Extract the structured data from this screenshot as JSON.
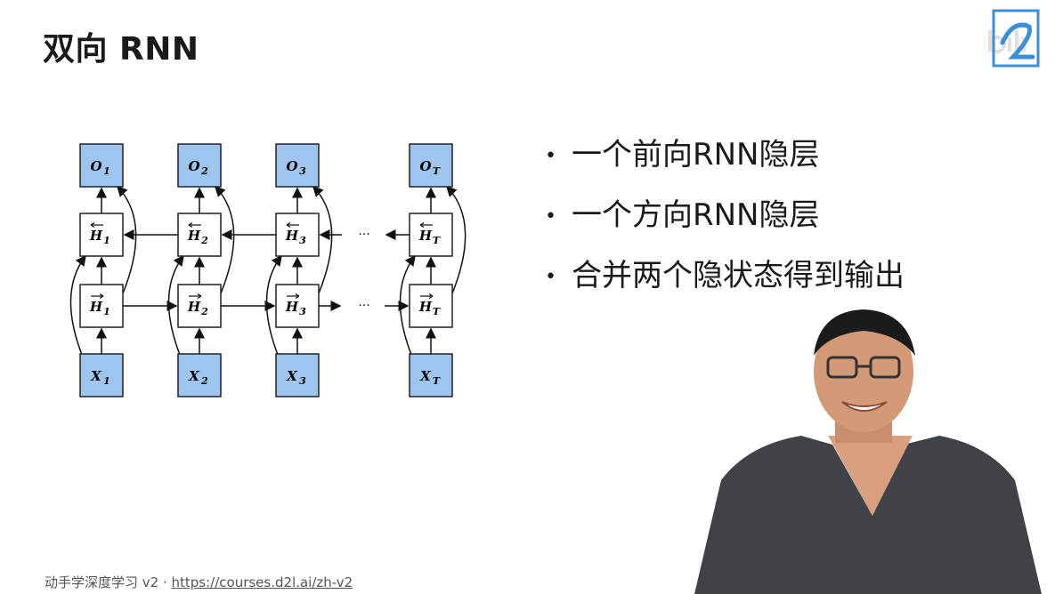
{
  "slide": {
    "title": "双向 RNN",
    "bullets": [
      "一个前向RNN隐层",
      "一个方向RNN隐层",
      "合并两个隐状态得到输出"
    ]
  },
  "diagram": {
    "outputs": [
      "O",
      "O",
      "O",
      "O"
    ],
    "output_subs": [
      "1",
      "2",
      "3",
      "T"
    ],
    "backward_hidden": [
      "H",
      "H",
      "H",
      "H"
    ],
    "backward_subs": [
      "1",
      "2",
      "3",
      "T"
    ],
    "forward_hidden": [
      "H",
      "H",
      "H",
      "H"
    ],
    "forward_subs": [
      "1",
      "2",
      "3",
      "T"
    ],
    "inputs": [
      "X",
      "X",
      "X",
      "X"
    ],
    "input_subs": [
      "1",
      "2",
      "3",
      "T"
    ],
    "ellipsis": "···"
  },
  "footer": {
    "text": "动手学深度学习 v2 · ",
    "link": "https://courses.d2l.ai/zh-v2"
  },
  "colors": {
    "node_fill": "#9ec5ee",
    "hidden_fill": "#ffffff",
    "logo_blue": "#3a8fd8"
  },
  "icons": {
    "logo": "d2l-logo",
    "watermark": "bilibili-watermark"
  }
}
